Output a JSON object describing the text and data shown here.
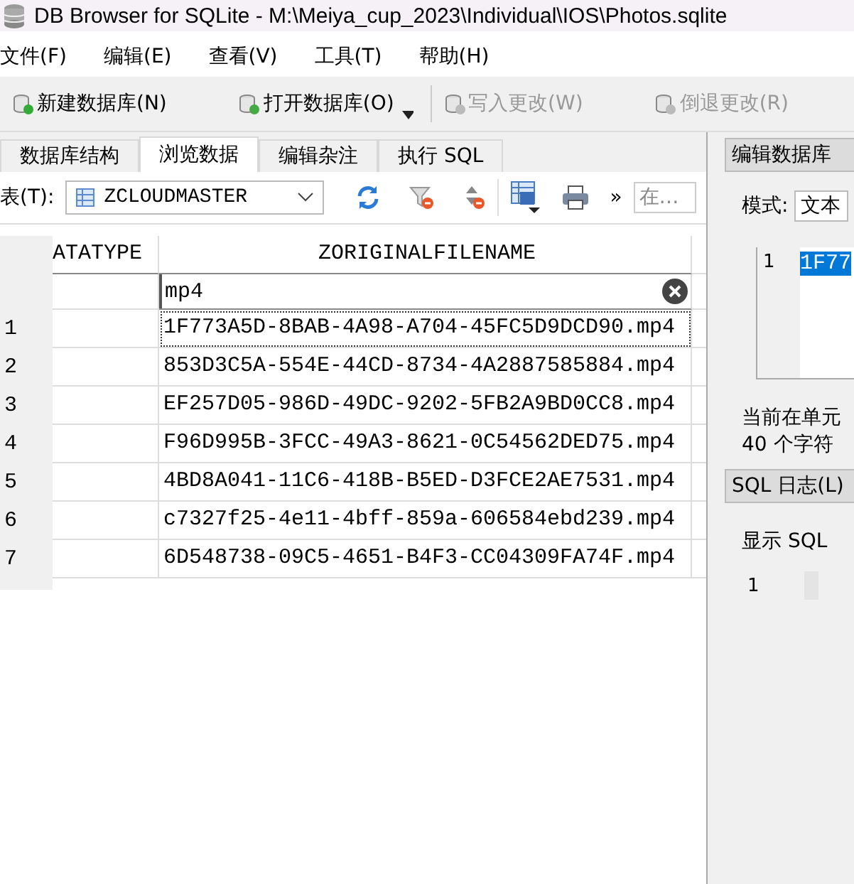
{
  "window": {
    "title": "DB Browser for SQLite - M:\\Meiya_cup_2023\\Individual\\IOS\\Photos.sqlite"
  },
  "menu": [
    "文件(F)",
    "编辑(E)",
    "查看(V)",
    "工具(T)",
    "帮助(H)"
  ],
  "toolbar": [
    {
      "label": "新建数据库(N)",
      "disabled": false
    },
    {
      "label": "打开数据库(O)",
      "disabled": false
    },
    {
      "label": "写入更改(W)",
      "disabled": true
    },
    {
      "label": "倒退更改(R)",
      "disabled": true
    }
  ],
  "tabs": [
    {
      "label": "数据库结构",
      "selected": false
    },
    {
      "label": "浏览数据",
      "selected": true
    },
    {
      "label": "编辑杂注",
      "selected": false
    },
    {
      "label": "执行 SQL",
      "selected": false
    }
  ],
  "browse": {
    "table_label": "表(T):",
    "table_value": "ZCLOUDMASTER",
    "overflow": "»",
    "search_placeholder": "在…"
  },
  "grid": {
    "columns": [
      "ATATYPE",
      "ZORIGINALFILENAME"
    ],
    "filter_value": "mp4",
    "rows": [
      {
        "number": "1",
        "filename": "1F773A5D-8BAB-4A98-A704-45FC5D9DCD90.mp4",
        "focused": true
      },
      {
        "number": "2",
        "filename": "853D3C5A-554E-44CD-8734-4A2887585884.mp4",
        "focused": false
      },
      {
        "number": "3",
        "filename": "EF257D05-986D-49DC-9202-5FB2A9BD0CC8.mp4",
        "focused": false
      },
      {
        "number": "4",
        "filename": "F96D995B-3FCC-49A3-8621-0C54562DED75.mp4",
        "focused": false
      },
      {
        "number": "5",
        "filename": "4BD8A041-11C6-418B-B5ED-D3FCE2AE7531.mp4",
        "focused": false
      },
      {
        "number": "6",
        "filename": "c7327f25-4e11-4bff-859a-606584ebd239.mp4",
        "focused": false
      },
      {
        "number": "7",
        "filename": "6D548738-09C5-4651-B4F3-CC04309FA74F.mp4",
        "focused": false
      }
    ]
  },
  "edit_cell": {
    "title": "编辑数据库",
    "mode_label": "模式:",
    "mode_value": "文本",
    "line_number": "1",
    "value": "1F77",
    "info": "当前在单元",
    "char_count": "40 个字符"
  },
  "sql_log": {
    "title": "SQL 日志(L)",
    "show_label": "显示 SQL",
    "line_number": "1"
  }
}
